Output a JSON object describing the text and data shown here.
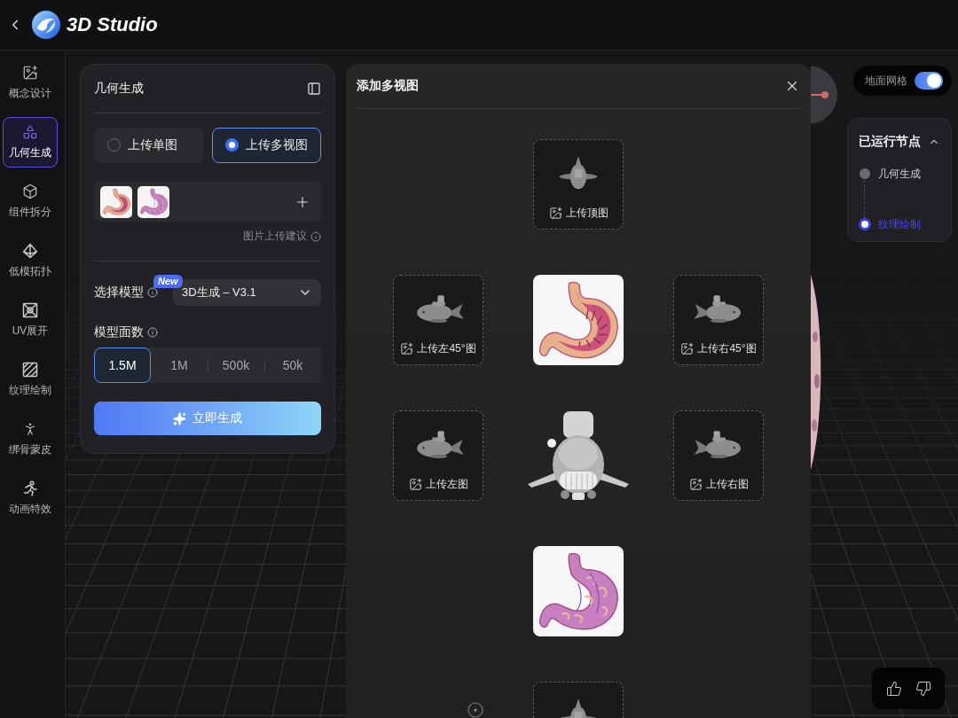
{
  "header": {
    "title": "3D Studio"
  },
  "sidebar": {
    "items": [
      {
        "label": "概念设计",
        "selected": false
      },
      {
        "label": "几何生成",
        "selected": true
      },
      {
        "label": "组件拆分",
        "selected": false
      },
      {
        "label": "低模拓扑",
        "selected": false
      },
      {
        "label": "UV展开",
        "selected": false
      },
      {
        "label": "纹理绘制",
        "selected": false
      },
      {
        "label": "绑骨蒙皮",
        "selected": false
      },
      {
        "label": "动画特效",
        "selected": false
      }
    ]
  },
  "geometry_panel": {
    "title": "几何生成",
    "upload_modes": [
      {
        "label": "上传单图",
        "selected": false
      },
      {
        "label": "上传多视图",
        "selected": true
      }
    ],
    "thumbnails": [
      {
        "kind": "cutaway"
      },
      {
        "kind": "exterior"
      }
    ],
    "upload_hint": "图片上传建议",
    "model_select": {
      "label": "选择模型",
      "badge": "New",
      "value": "3D生成 – V3.1"
    },
    "face_count": {
      "label": "模型面数",
      "options": [
        {
          "label": "1.5M",
          "selected": true
        },
        {
          "label": "1M",
          "selected": false
        },
        {
          "label": "500k",
          "selected": false
        },
        {
          "label": "50k",
          "selected": false
        }
      ]
    },
    "generate_button": {
      "label": "立即生成"
    }
  },
  "dialog": {
    "title": "添加多视图",
    "slots": [
      {
        "kind": "upload",
        "label": "上传顶图"
      },
      {
        "kind": "upload",
        "label": "上传左45°图"
      },
      {
        "kind": "photo"
      },
      {
        "kind": "upload",
        "label": "上传右45°图"
      },
      {
        "kind": "upload",
        "label": "上传左图"
      },
      {
        "kind": "render"
      },
      {
        "kind": "upload",
        "label": "上传右图"
      },
      {
        "kind": "photo"
      },
      {
        "kind": "upload"
      }
    ]
  },
  "ground_grid": {
    "label": "地面网格",
    "on": true
  },
  "run_nodes": {
    "title": "已运行节点",
    "expanded": true,
    "nodes": [
      {
        "label": "几何生成",
        "selected": false
      },
      {
        "label": "纹理绘制",
        "selected": true
      }
    ]
  }
}
